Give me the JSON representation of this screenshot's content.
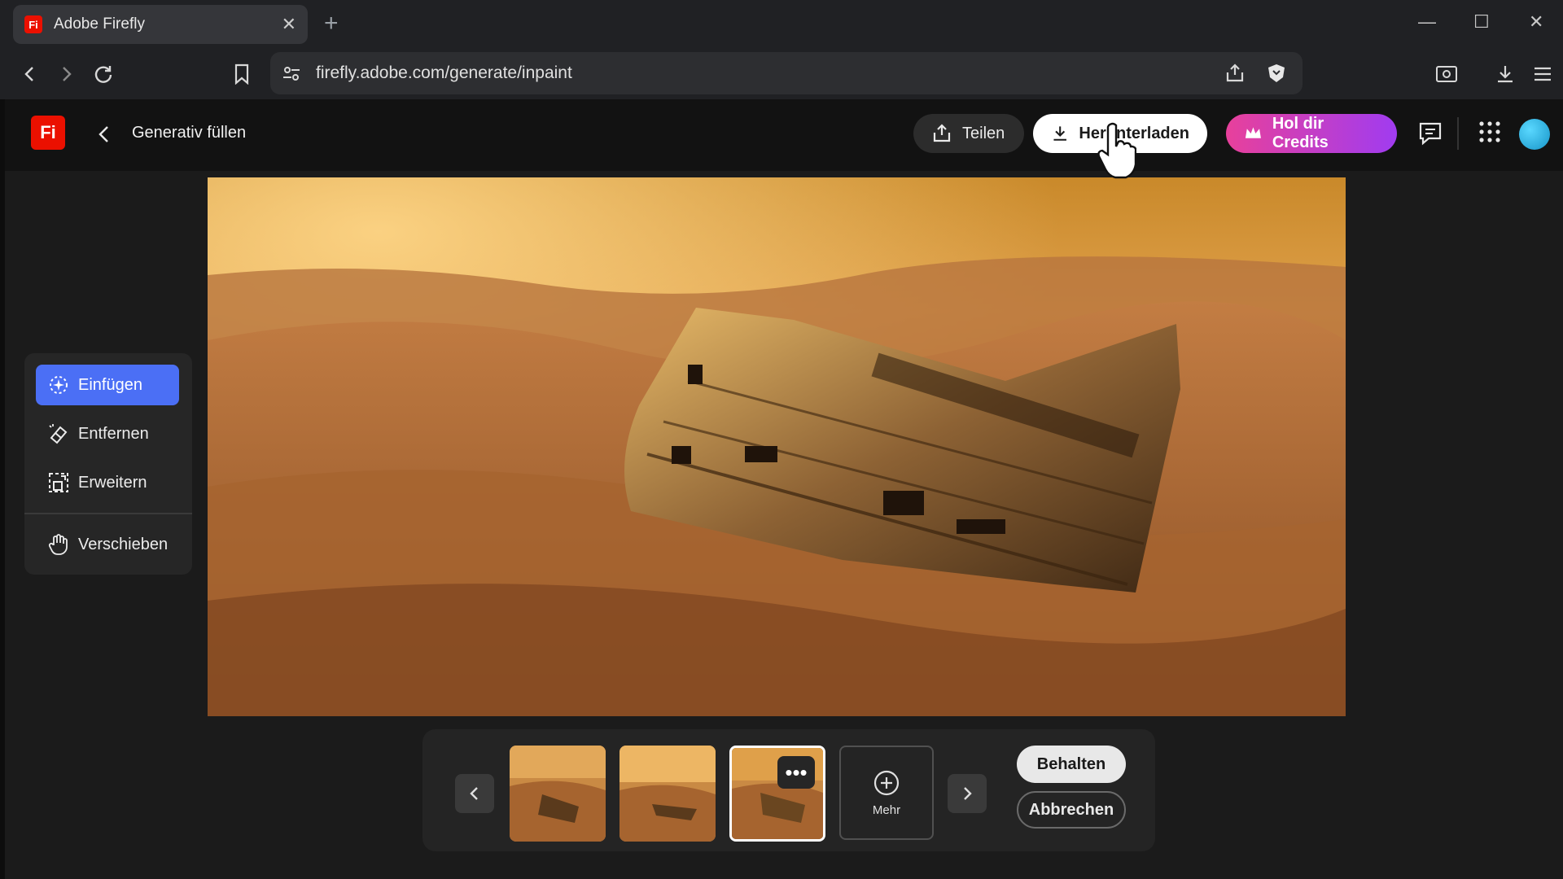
{
  "browser": {
    "tab_title": "Adobe Firefly",
    "tab_favicon_label": "Fi",
    "new_tab_symbol": "+",
    "close_tab_symbol": "✕",
    "url": "firefly.adobe.com/generate/inpaint",
    "window_controls": {
      "minimize": "—",
      "maximize": "☐",
      "close": "✕"
    }
  },
  "header": {
    "logo_label": "Fi",
    "page_title": "Generativ füllen",
    "share_label": "Teilen",
    "download_label": "Herunterladen",
    "credits_label": "Hol dir Credits",
    "brand_gradient": [
      "#e8409b",
      "#a03cf0"
    ]
  },
  "tools": {
    "items": [
      {
        "label": "Einfügen",
        "icon": "insert-sparkle-icon",
        "active": true
      },
      {
        "label": "Entfernen",
        "icon": "eraser-icon",
        "active": false
      },
      {
        "label": "Erweitern",
        "icon": "expand-icon",
        "active": false
      },
      {
        "label": "Verschieben",
        "icon": "hand-icon",
        "active": false
      }
    ],
    "active_color": "#4b6ff5"
  },
  "variations": {
    "count_thumbnails": 3,
    "selected_index": 2,
    "more_label": "Mehr",
    "keep_label": "Behalten",
    "cancel_label": "Abbrechen",
    "options_symbol": "•••"
  }
}
